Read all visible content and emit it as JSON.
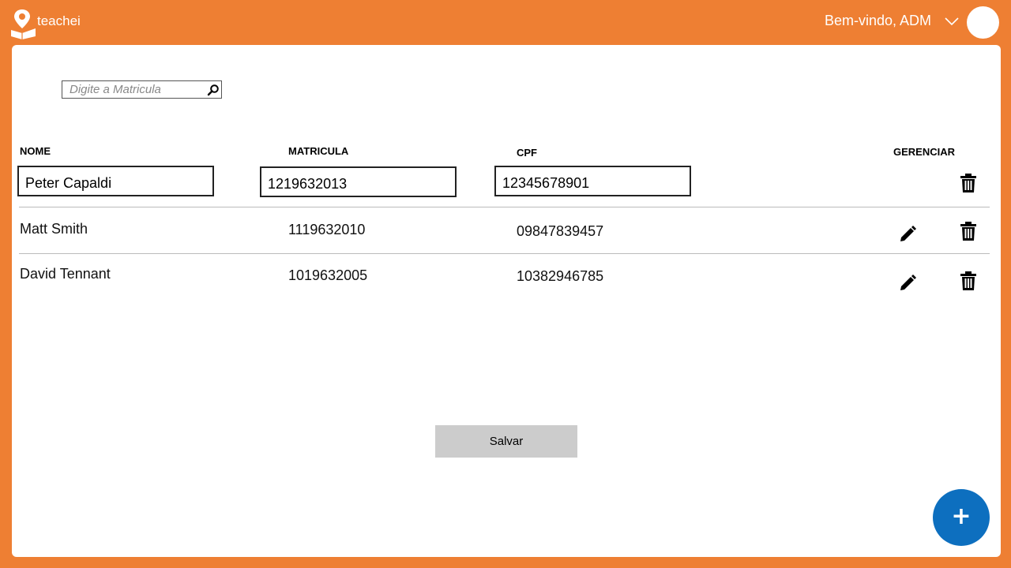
{
  "header": {
    "logo_text": "teachei",
    "welcome": "Bem-vindo, ADM"
  },
  "search": {
    "placeholder": "Digite a Matricula"
  },
  "table": {
    "headers": {
      "nome": "NOME",
      "matricula": "MATRICULA",
      "cpf": "CPF",
      "gerenciar": "GERENCIAR"
    },
    "editing_row": {
      "nome": "Peter Capaldi",
      "matricula": "1219632013",
      "cpf": "12345678901"
    },
    "rows": [
      {
        "nome": "Matt Smith",
        "matricula": "1119632010",
        "cpf": "09847839457"
      },
      {
        "nome": "David Tennant",
        "matricula": "1019632005",
        "cpf": "10382946785"
      }
    ]
  },
  "actions": {
    "save_label": "Salvar",
    "add_label": "+"
  },
  "colors": {
    "background": "#ee7f33",
    "panel": "#ffffff",
    "fab": "#0d6fbf",
    "save_button": "#cccccc"
  },
  "icons": [
    "map-pin-book-logo-icon",
    "chevron-down-icon",
    "search-icon",
    "pencil-icon",
    "trash-icon"
  ]
}
